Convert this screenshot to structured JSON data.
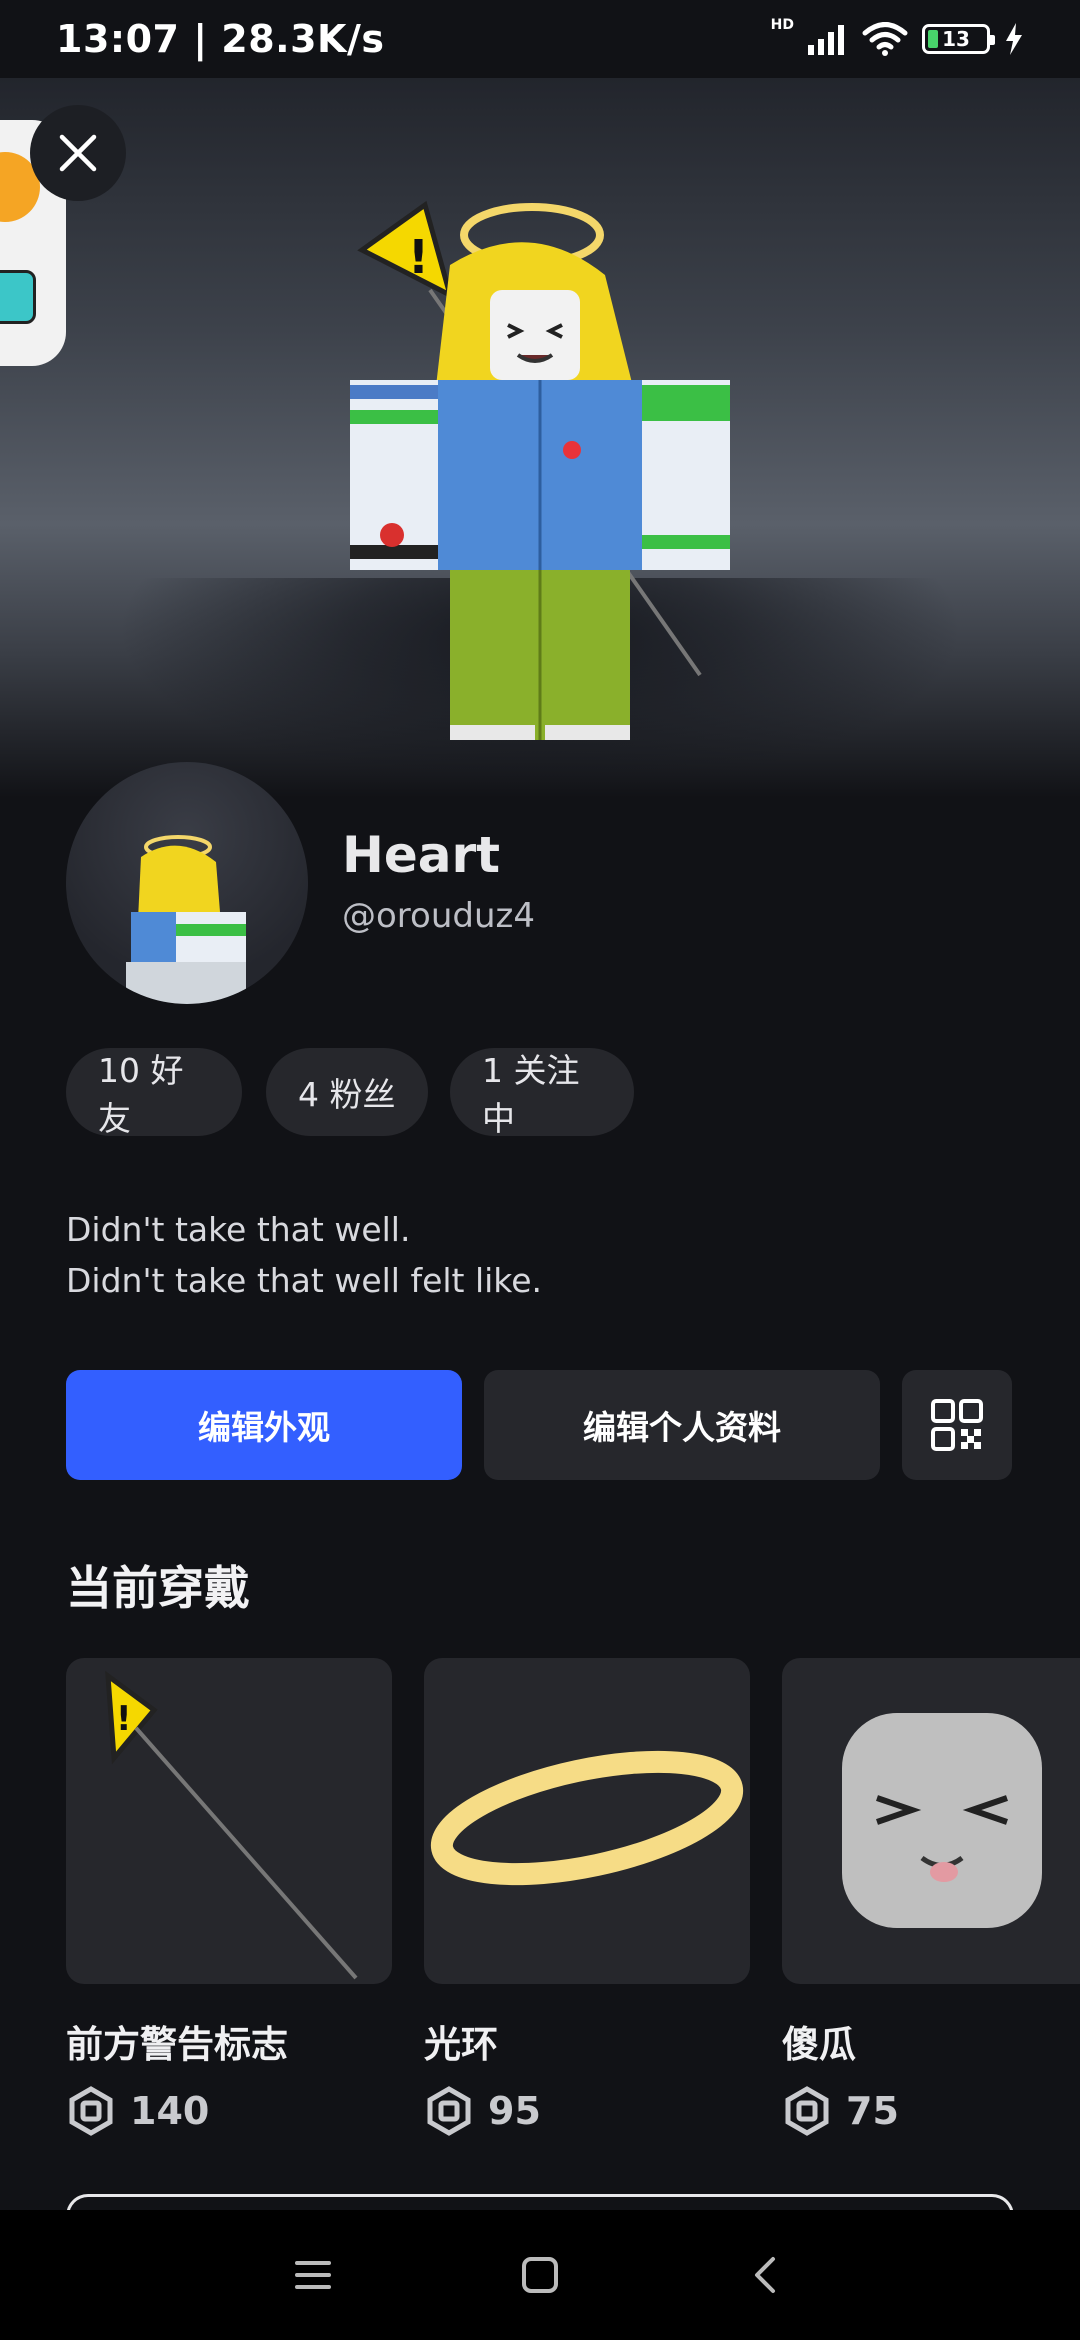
{
  "status_bar": {
    "time_speed": "13:07 | 28.3K/s",
    "network": "HD",
    "battery": "13"
  },
  "profile": {
    "display_name": "Heart",
    "username": "@orouduz4"
  },
  "stats": {
    "friends": "10 好友",
    "followers": "4 粉丝",
    "following": "1 关注中"
  },
  "bio": {
    "line1": "Didn't take that well.",
    "line2": "Didn't take that well felt like."
  },
  "actions": {
    "edit_outfit": "编辑外观",
    "edit_profile": "编辑个人资料"
  },
  "current_wearing": {
    "title": "当前穿戴",
    "items": [
      {
        "name": "前方警告标志",
        "price": "140"
      },
      {
        "name": "光环",
        "price": "95"
      },
      {
        "name": "傻瓜",
        "price": "75"
      }
    ]
  },
  "colors": {
    "accent": "#335fff",
    "background": "#111216",
    "chip": "#26272c"
  }
}
